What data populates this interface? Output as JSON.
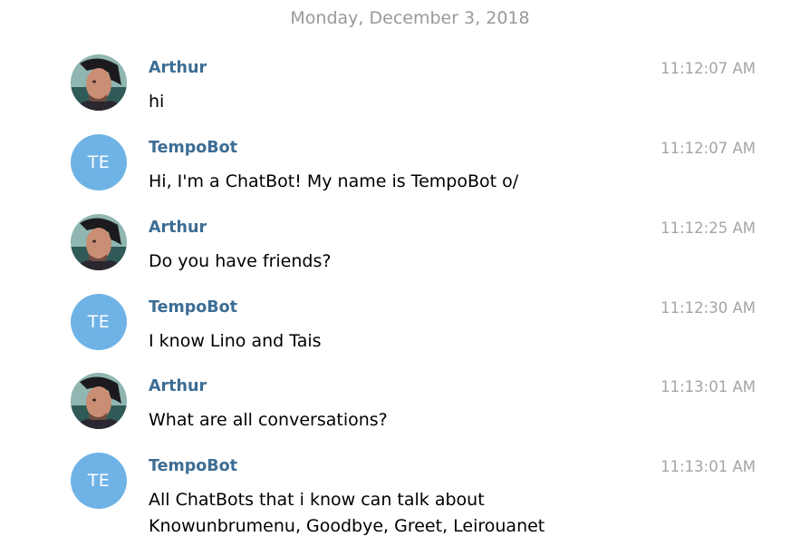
{
  "chat": {
    "date": "Monday, December 3, 2018",
    "messages": [
      {
        "sender": "Arthur",
        "avatar": "photo",
        "time": "11:12:07 AM",
        "lines": [
          "hi"
        ]
      },
      {
        "sender": "TempoBot",
        "avatar": "TE",
        "time": "11:12:07 AM",
        "lines": [
          "Hi, I'm a ChatBot! My name is TempoBot o/"
        ]
      },
      {
        "sender": "Arthur",
        "avatar": "photo",
        "time": "11:12:25 AM",
        "lines": [
          "Do you have friends?"
        ]
      },
      {
        "sender": "TempoBot",
        "avatar": "TE",
        "time": "11:12:30 AM",
        "lines": [
          "I know Lino and Tais"
        ]
      },
      {
        "sender": "Arthur",
        "avatar": "photo",
        "time": "11:13:01 AM",
        "lines": [
          "What are all conversations?"
        ]
      },
      {
        "sender": "TempoBot",
        "avatar": "TE",
        "time": "11:13:01 AM",
        "lines": [
          "All ChatBots that i know can talk about",
          "Knowunbrumenu, Goodbye, Greet, Leirouanet"
        ]
      }
    ]
  },
  "colors": {
    "sender_name": "#3c6d94",
    "timestamp": "#a5a5a5",
    "date_header": "#999999",
    "bot_avatar_bg": "#6fb3e6"
  }
}
